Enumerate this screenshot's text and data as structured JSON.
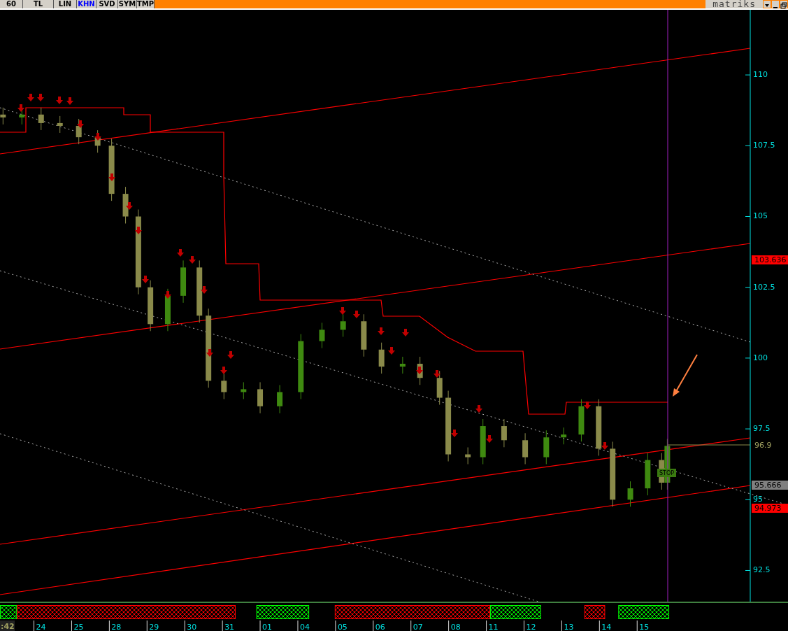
{
  "toolbar": {
    "buttons": [
      {
        "label": "60",
        "selected": false
      },
      {
        "label": "TL",
        "selected": false
      },
      {
        "label": "LIN",
        "selected": false
      },
      {
        "label": "KHN",
        "selected": true
      },
      {
        "label": "SVD",
        "selected": false
      },
      {
        "label": "SYM",
        "selected": false
      },
      {
        "label": "TMP",
        "selected": false
      }
    ],
    "logo": "matriks"
  },
  "chart": {
    "price_axis_labels": [
      "110",
      "107.5",
      "105",
      "102.5",
      "100",
      "97.5",
      "95",
      "92.5"
    ],
    "price_labels": [
      {
        "text": "103.636",
        "kind": "box",
        "color": "#ff0000"
      },
      {
        "text": "96.9",
        "kind": "plain",
        "color": "#a0a060"
      },
      {
        "text": "95.666",
        "kind": "box",
        "color": "#808080"
      },
      {
        "text": "94.973",
        "kind": "box",
        "color": "#ff0000"
      }
    ],
    "stop_label": "STOP",
    "time_label": ":42",
    "date_labels": [
      "24",
      "25",
      "28",
      "29",
      "30",
      "31",
      "01",
      "04",
      "05",
      "06",
      "07",
      "08",
      "11",
      "12",
      "13",
      "14",
      "15"
    ],
    "signal_bars": [
      {
        "color": "#00ff00"
      },
      {
        "color": "#ff0000"
      },
      {
        "color": "#00ff00"
      },
      {
        "color": "#ff0000"
      },
      {
        "color": "#00ff00"
      },
      {
        "color": "#ff0000"
      },
      {
        "color": "#00ff00"
      }
    ]
  }
}
